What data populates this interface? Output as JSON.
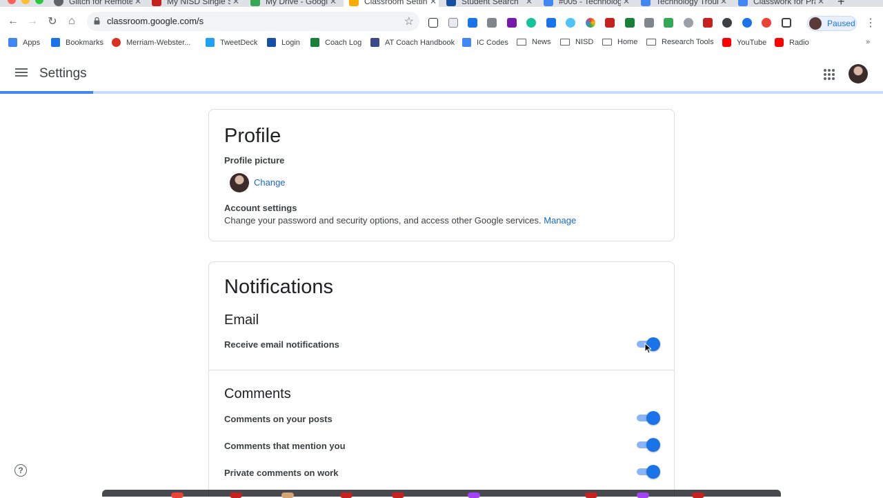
{
  "browser": {
    "tabs": [
      {
        "title": "Glitch for Remote",
        "icon": "globe-icon",
        "color": "#5f6368",
        "active": false
      },
      {
        "title": "My NISD Single S",
        "icon": "nisd-icon",
        "color": "#c5221f",
        "active": false
      },
      {
        "title": "My Drive - Google",
        "icon": "drive-icon",
        "color": "#34a853",
        "active": false
      },
      {
        "title": "Classroom Setting",
        "icon": "classroom-icon",
        "color": "#f9ab00",
        "active": true
      },
      {
        "title": "Student Search",
        "icon": "esp-icon",
        "color": "#174ea6",
        "active": false
      },
      {
        "title": "#005 - Technolog",
        "icon": "classroom-icon",
        "color": "#4285f4",
        "active": false
      },
      {
        "title": "Technology Troub",
        "icon": "docs-icon",
        "color": "#4285f4",
        "active": false
      },
      {
        "title": "Classwork for Pra",
        "icon": "classroom-icon",
        "color": "#4285f4",
        "active": false
      }
    ],
    "url": "classroom.google.com/s",
    "profile_status": "Paused",
    "bookmarks": [
      {
        "label": "Apps",
        "icon": "apps-icon",
        "color": "#4285f4"
      },
      {
        "label": "Bookmarks",
        "icon": "star-icon",
        "color": "#1a73e8"
      },
      {
        "label": "Merriam-Webster...",
        "icon": "mw-icon",
        "color": "#d93025"
      },
      {
        "label": "TweetDeck",
        "icon": "twitter-icon",
        "color": "#1da1f2"
      },
      {
        "label": "Login",
        "icon": "esp-icon",
        "color": "#174ea6"
      },
      {
        "label": "Coach Log",
        "icon": "sheets-icon",
        "color": "#188038"
      },
      {
        "label": "AT Coach Handbook",
        "icon": "forms-icon",
        "color": "#3c4a8c"
      },
      {
        "label": "IC Codes",
        "icon": "docs-icon",
        "color": "#4285f4"
      },
      {
        "label": "News",
        "icon": "folder-icon",
        "color": "#5f6368"
      },
      {
        "label": "NISD",
        "icon": "folder-icon",
        "color": "#5f6368"
      },
      {
        "label": "Home",
        "icon": "folder-icon",
        "color": "#5f6368"
      },
      {
        "label": "Research Tools",
        "icon": "folder-icon",
        "color": "#5f6368"
      },
      {
        "label": "YouTube",
        "icon": "youtube-icon",
        "color": "#ff0000"
      },
      {
        "label": "Radio",
        "icon": "youtube-icon",
        "color": "#ff0000"
      }
    ],
    "more_bookmarks": "»"
  },
  "app": {
    "title": "Settings"
  },
  "profile": {
    "heading": "Profile",
    "picture_label": "Profile picture",
    "change_link": "Change",
    "account_label": "Account settings",
    "account_desc": "Change your password and security options, and access other Google services.",
    "manage_link": "Manage"
  },
  "notifications": {
    "heading": "Notifications",
    "email": {
      "heading": "Email",
      "receive_label": "Receive email notifications",
      "receive_on": true
    },
    "comments": {
      "heading": "Comments",
      "items": [
        {
          "label": "Comments on your posts",
          "on": true
        },
        {
          "label": "Comments that mention you",
          "on": true
        },
        {
          "label": "Private comments on work",
          "on": true
        }
      ]
    }
  },
  "help": {
    "icon": "help-icon",
    "glyph": "?"
  },
  "colors": {
    "accent": "#1a73e8",
    "link": "#1967d2",
    "toggle_track": "#8ab4f8"
  }
}
